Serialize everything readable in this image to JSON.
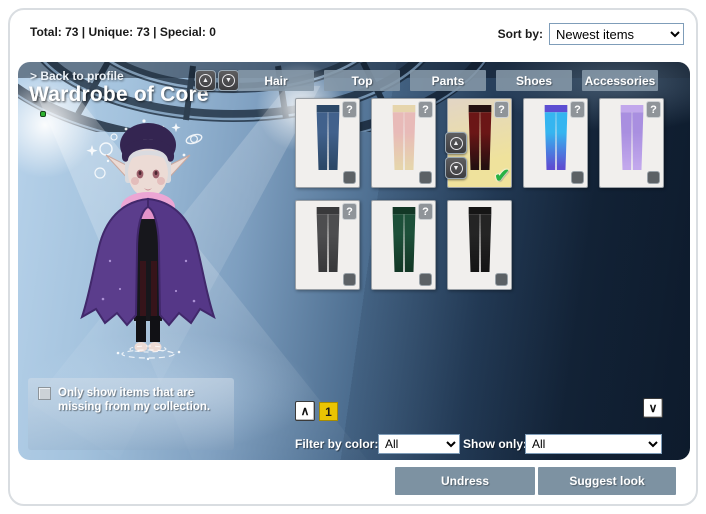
{
  "header": {
    "stats_text": "Total: 73 | Unique: 73 | Special: 0",
    "sort_label": "Sort by:",
    "sort_value": "Newest items"
  },
  "wardrobe": {
    "back_link": "> Back to profile",
    "title": "Wardrobe of Core",
    "status_dot_color": "#2fb32f",
    "tabs": [
      {
        "label": "Hair",
        "active": false
      },
      {
        "label": "Top",
        "active": false
      },
      {
        "label": "Pants",
        "active": true
      },
      {
        "label": "Shoes",
        "active": false
      },
      {
        "label": "Accessories",
        "active": false
      }
    ],
    "items": [
      {
        "desc": "blue jeans",
        "colors": [
          "#41618c",
          "#2c4868"
        ],
        "selected": false,
        "has_help": true
      },
      {
        "desc": "pink striped tights",
        "colors": [
          "#e8bab8",
          "#e6d5ac"
        ],
        "selected": false,
        "has_help": true
      },
      {
        "desc": "red plaid pants",
        "colors": [
          "#6b1616",
          "#241010"
        ],
        "selected": true,
        "has_help": true
      },
      {
        "desc": "blue purple gradient tights",
        "colors": [
          "#35b5f0",
          "#5d4ed2"
        ],
        "selected": false,
        "has_help": true
      },
      {
        "desc": "lilac sparkle pants",
        "colors": [
          "#a98fe0",
          "#c2a8ec"
        ],
        "selected": false,
        "has_help": true
      },
      {
        "desc": "gray cuffed jeans",
        "colors": [
          "#4d4d4f",
          "#39393b"
        ],
        "selected": false,
        "has_help": true
      },
      {
        "desc": "dark green pants",
        "colors": [
          "#1d5039",
          "#133826"
        ],
        "selected": false,
        "has_help": true
      },
      {
        "desc": "black cargo pants",
        "colors": [
          "#242424",
          "#151515"
        ],
        "selected": false,
        "has_help": false
      }
    ],
    "selected_card_bg": [
      "#e2d5c5",
      "#efe29c"
    ],
    "help_icon": "?",
    "selected_check_icon": "✔",
    "layer_controls": {
      "up_icon": "▲",
      "down_icon": "▼"
    },
    "avatar_controls": {
      "up_icon": "▲",
      "down_icon": "▼"
    },
    "missing_filter": {
      "label": "Only show items that are missing from my collection.",
      "checked": false
    },
    "pagination": {
      "up_icon": "∧",
      "current_page": "1",
      "down_icon": "∨"
    },
    "filters": {
      "color_label": "Filter by color:",
      "color_value": "All",
      "show_label": "Show only:",
      "show_value": "All"
    }
  },
  "footer": {
    "undress_label": "Undress",
    "suggest_label": "Suggest look"
  }
}
